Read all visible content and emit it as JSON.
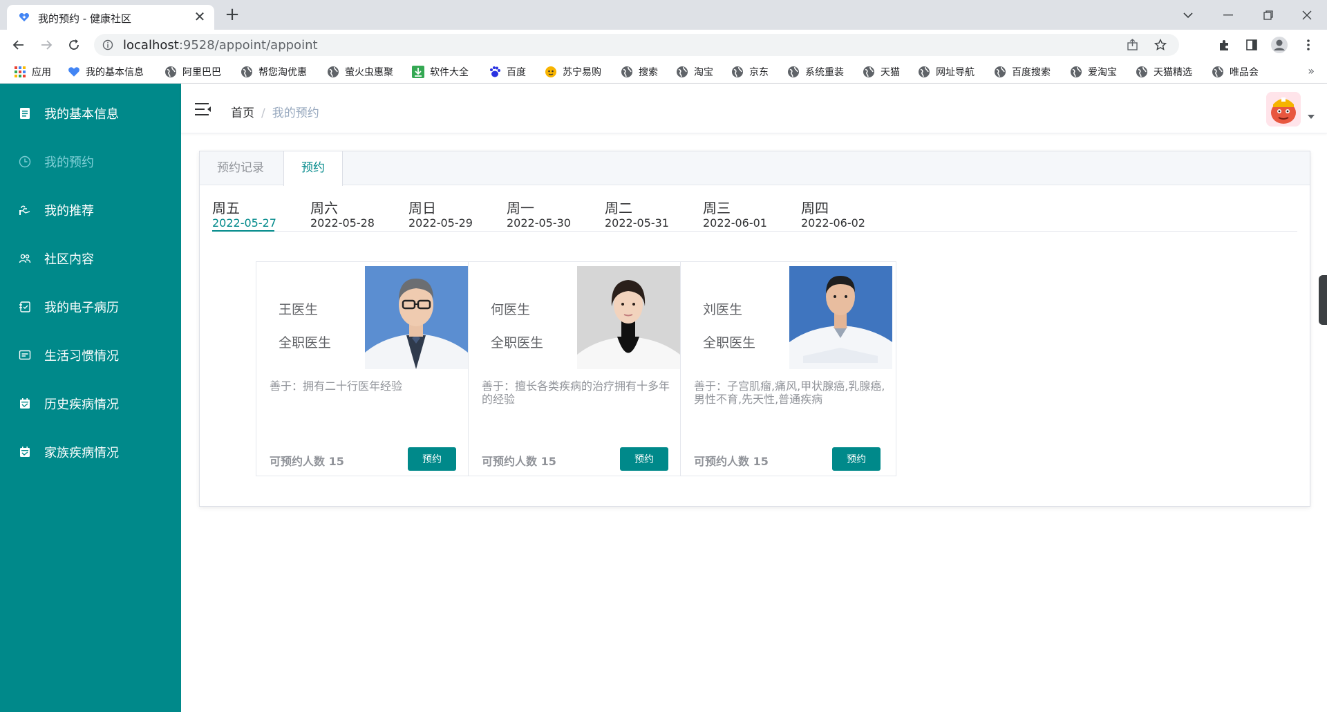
{
  "browser": {
    "tab_title": "我的预约 - 健康社区",
    "close_glyph": "✕",
    "newtab_glyph": "+",
    "url_host": "localhost",
    "url_path": ":9528/appoint/appoint",
    "bookmarks_more": "»",
    "bookmarks": [
      {
        "label": "应用",
        "icon": "apps-grid-icon"
      },
      {
        "label": "我的基本信息",
        "icon": "heart-icon"
      },
      {
        "label": "阿里巴巴",
        "icon": "globe-icon"
      },
      {
        "label": "帮您淘优惠",
        "icon": "globe-icon"
      },
      {
        "label": "萤火虫惠聚",
        "icon": "globe-icon"
      },
      {
        "label": "软件大全",
        "icon": "download-icon"
      },
      {
        "label": "百度",
        "icon": "baidu-paw-icon"
      },
      {
        "label": "苏宁易购",
        "icon": "suning-icon"
      },
      {
        "label": "搜索",
        "icon": "globe-icon"
      },
      {
        "label": "淘宝",
        "icon": "globe-icon"
      },
      {
        "label": "京东",
        "icon": "globe-icon"
      },
      {
        "label": "系统重装",
        "icon": "globe-icon"
      },
      {
        "label": "天猫",
        "icon": "globe-icon"
      },
      {
        "label": "网址导航",
        "icon": "globe-icon"
      },
      {
        "label": "百度搜索",
        "icon": "globe-icon"
      },
      {
        "label": "爱淘宝",
        "icon": "globe-icon"
      },
      {
        "label": "天猫精选",
        "icon": "globe-icon"
      },
      {
        "label": "唯品会",
        "icon": "globe-icon"
      }
    ]
  },
  "sidebar": {
    "items": [
      {
        "label": "我的基本信息",
        "icon": "document-icon",
        "active": false
      },
      {
        "label": "我的预约",
        "icon": "clock-icon",
        "active": true
      },
      {
        "label": "我的推荐",
        "icon": "hand-icon",
        "active": false
      },
      {
        "label": "社区内容",
        "icon": "people-icon",
        "active": false
      },
      {
        "label": "我的电子病历",
        "icon": "record-icon",
        "active": false
      },
      {
        "label": "生活习惯情况",
        "icon": "message-icon",
        "active": false
      },
      {
        "label": "历史疾病情况",
        "icon": "calendar-icon",
        "active": false
      },
      {
        "label": "家族疾病情况",
        "icon": "calendar-icon",
        "active": false
      }
    ],
    "bg_color": "#00898a"
  },
  "header": {
    "breadcrumb_home": "首页",
    "breadcrumb_sep": "/",
    "breadcrumb_current": "我的预约"
  },
  "panel": {
    "tabs": [
      {
        "label": "预约记录",
        "active": false
      },
      {
        "label": "预约",
        "active": true
      }
    ],
    "days": [
      {
        "weekday": "周五",
        "date": "2022-05-27",
        "active": true
      },
      {
        "weekday": "周六",
        "date": "2022-05-28",
        "active": false
      },
      {
        "weekday": "周日",
        "date": "2022-05-29",
        "active": false
      },
      {
        "weekday": "周一",
        "date": "2022-05-30",
        "active": false
      },
      {
        "weekday": "周二",
        "date": "2022-05-31",
        "active": false
      },
      {
        "weekday": "周三",
        "date": "2022-06-01",
        "active": false
      },
      {
        "weekday": "周四",
        "date": "2022-06-02",
        "active": false
      }
    ],
    "doctors": [
      {
        "name": "王医生",
        "title": "全职医生",
        "skill": "善于：拥有二十行医年经验",
        "quota": "可预约人数 15",
        "button": "预约"
      },
      {
        "name": "何医生",
        "title": "全职医生",
        "skill": "善于：擅长各类疾病的治疗拥有十多年的经验",
        "quota": "可预约人数 15",
        "button": "预约"
      },
      {
        "name": "刘医生",
        "title": "全职医生",
        "skill": "善于：子宫肌瘤,痛风,甲状腺癌,乳腺癌,男性不育,先天性,普通疾病",
        "quota": "可预约人数 15",
        "button": "预约"
      }
    ]
  },
  "colors": {
    "accent": "#00898a",
    "breadcrumb_current": "#97a8be"
  }
}
